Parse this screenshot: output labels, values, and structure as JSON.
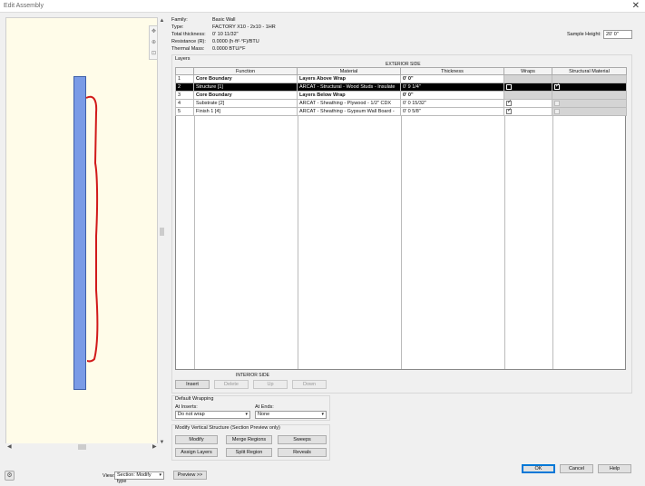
{
  "window": {
    "title": "Edit Assembly",
    "close_label": "✕"
  },
  "properties": {
    "family_label": "Family:",
    "family_value": "Basic Wall",
    "type_label": "Type:",
    "type_value": "FACTORY X10 - 2x10 - 1HR",
    "thickness_label": "Total thickness:",
    "thickness_value": "0'  10 11/32\"",
    "resistance_label": "Resistance (R):",
    "resistance_value": "0.0000 (h·ft²·°F)/BTU",
    "mass_label": "Thermal Mass:",
    "mass_value": "0.0000 BTU/°F"
  },
  "sample_height": {
    "label": "Sample Height:",
    "value": "20'  0\""
  },
  "layers": {
    "title": "Layers",
    "exterior_label": "EXTERIOR SIDE",
    "interior_label": "INTERIOR SIDE",
    "columns": [
      "",
      "Function",
      "Material",
      "Thickness",
      "Wraps",
      "Structural Material"
    ],
    "rows": [
      {
        "num": "1",
        "function": "Core Boundary",
        "material": "Layers Above Wrap",
        "thickness": "0'  0\"",
        "wraps": null,
        "structural": null,
        "bold": true,
        "selected": false
      },
      {
        "num": "2",
        "function": "Structure [1]",
        "material": "ARCAT - Structural - Wood Studs - Insulate",
        "thickness": "0'  9 1/4\"",
        "wraps": false,
        "structural": true,
        "bold": false,
        "selected": true
      },
      {
        "num": "3",
        "function": "Core Boundary",
        "material": "Layers Below Wrap",
        "thickness": "0'  0\"",
        "wraps": null,
        "structural": null,
        "bold": true,
        "selected": false
      },
      {
        "num": "4",
        "function": "Substrate [2]",
        "material": "ARCAT - Sheathing - Plywood - 1/2\" CDX",
        "thickness": "0'  0 15/32\"",
        "wraps": true,
        "structural": false,
        "bold": false,
        "selected": false
      },
      {
        "num": "5",
        "function": "Finish 1 [4]",
        "material": "ARCAT - Sheathing - Gypsum Wall Board -",
        "thickness": "0'  0 5/8\"",
        "wraps": true,
        "structural": false,
        "bold": false,
        "selected": false
      }
    ]
  },
  "layer_buttons": {
    "insert": "Insert",
    "delete": "Delete",
    "up": "Up",
    "down": "Down"
  },
  "default_wrapping": {
    "title": "Default Wrapping",
    "inserts_label": "At Inserts:",
    "inserts_value": "Do not wrap",
    "ends_label": "At Ends:",
    "ends_value": "None"
  },
  "modify_structure": {
    "title": "Modify Vertical Structure (Section Preview only)",
    "modify": "Modify",
    "merge": "Merge Regions",
    "sweeps": "Sweeps",
    "assign": "Assign Layers",
    "split": "Split Region",
    "reveals": "Reveals"
  },
  "view": {
    "label": "View:",
    "value": "Section: Modify type",
    "preview_btn": "Preview >>"
  },
  "dialog_buttons": {
    "ok": "OK",
    "cancel": "Cancel",
    "help": "Help"
  },
  "colors": {
    "wall": "#7a9be6",
    "sketch": "#d11a1a",
    "preview_bg": "#fffce9"
  }
}
